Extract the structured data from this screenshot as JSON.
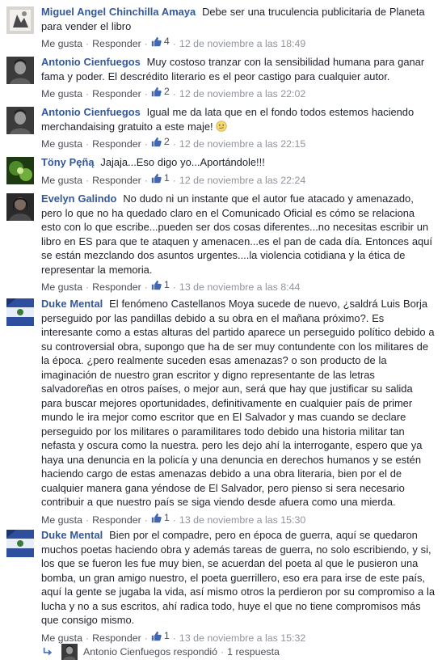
{
  "comments": [
    {
      "author": "Miguel Angel Chinchilla Amaya",
      "text": "Debe ser una truculencia publicitaria de Planeta para vender el libro",
      "like_label": "Me gusta",
      "reply_label": "Responder",
      "like_count": "4",
      "timestamp": "12 de noviembre a las 18:49",
      "avatar_icon": "book-cover-avatar"
    },
    {
      "author": "Antonio Cienfuegos",
      "text": "Muy costoso tranzar con la sensibilidad humana para ganar fama y poder. El descrédito literario es el peor castigo para cualquier autor.",
      "like_label": "Me gusta",
      "reply_label": "Responder",
      "like_count": "2",
      "timestamp": "12 de noviembre a las 22:02",
      "avatar_icon": "portrait-avatar"
    },
    {
      "author": "Antonio Cienfuegos",
      "text": "Igual me da lata que en el fondo todos estemos haciendo merchandaising gratuito a este maje!",
      "emoji": "confused-face-emoji",
      "like_label": "Me gusta",
      "reply_label": "Responder",
      "like_count": "2",
      "timestamp": "12 de noviembre a las 22:15",
      "avatar_icon": "portrait-avatar"
    },
    {
      "author": "Tönу Pęñą",
      "text": "Jajaja...Eso digo yo...Aportándole!!!",
      "like_label": "Me gusta",
      "reply_label": "Responder",
      "like_count": "1",
      "timestamp": "12 de noviembre a las 22:24",
      "avatar_icon": "green-abstract-avatar"
    },
    {
      "author": "Evelyn Galindo",
      "text": "No dudo ni un instante que el autor fue atacado y amenazado, pero lo que no ha quedado claro en el Comunicado Oficial es cómo se relaciona esto con lo que escribe...pueden ser dos cosas diferentes...no necesitas escribir un libro en ES para que te ataquen y amenacen...es el pan de cada día. Entonces aquí se están mezclando dos asuntos urgentes....la violencia cotidiana y la ética de representar la memoria.",
      "like_label": "Me gusta",
      "reply_label": "Responder",
      "like_count": "1",
      "timestamp": "13 de noviembre a las 8:44",
      "avatar_icon": "dark-photo-avatar"
    },
    {
      "author": "Duke Mental",
      "text": "El fenómeno Castellanos Moya sucede de nuevo, ¿saldrá Luis Borja perseguido por las pandillas debido a su obra en el mañana próximo?. Es interesante como a estas alturas del partido aparece un perseguido político debido a su controversial obra, supongo que ha de ser muy contundente con los militares de la época. ¿pero realmente suceden esas amenazas? o son producto de la imaginación de nuestro gran escritor y digno representante de las letras salvadoreñas en otros países, o mejor aun, será que hay que justificar su salida para buscar mejores oportunidades, definitivamente en cualquier país de primer mundo le ira mejor como escritor que en El Salvador y mas cuando se declare perseguido por los militares o paramilitares todo debido una historia militar tan nefasta y oscura como la nuestra. pero les dejo ahí la interrogante, espero que ya haya una denuncia en la policía y una denuncia en derechos humanos y se estén haciendo cargo de estas amenazas debido a una obra literaria, bien por el de cualquier manera gana yéndose de El Salvador, pero pienso si sera necesario contribuir a que nuestro país se siga viendo desde afuera como una mierda.",
      "like_label": "Me gusta",
      "reply_label": "Responder",
      "like_count": "1",
      "timestamp": "13 de noviembre a las 15:30",
      "avatar_icon": "blue-flag-avatar"
    },
    {
      "author": "Duke Mental",
      "text": "Bien por el compadre, pero en época de guerra, aquí se quedaron muchos poetas haciendo obra y además tareas de guerra, no solo escribiendo, y si, los que se fueron les fue muy bien, se acuerdan del poeta al que le pusieron una bomba, un gran amigo nuestro, el poeta guerrillero, eso era para irse de este país, aquí la gente se jugaba la vida, así mismo otros la perdieron por su compromiso a la lucha y no a sus escritos, ahí radica todo, huye el que no tiene compromisos más que consigo mismo.",
      "like_label": "Me gusta",
      "reply_label": "Responder",
      "like_count": "1",
      "timestamp": "13 de noviembre a las 15:32",
      "avatar_icon": "blue-flag-avatar"
    }
  ],
  "replies": {
    "author": "Antonio Cienfuegos",
    "action": "respondió",
    "count_label": "1 respuesta",
    "icon": "reply-arrow-icon"
  },
  "colors": {
    "author": "#365899",
    "text": "#1d2129",
    "meta": "#90949c",
    "link": "#4b4f56",
    "like_blue": "#4267b2"
  }
}
